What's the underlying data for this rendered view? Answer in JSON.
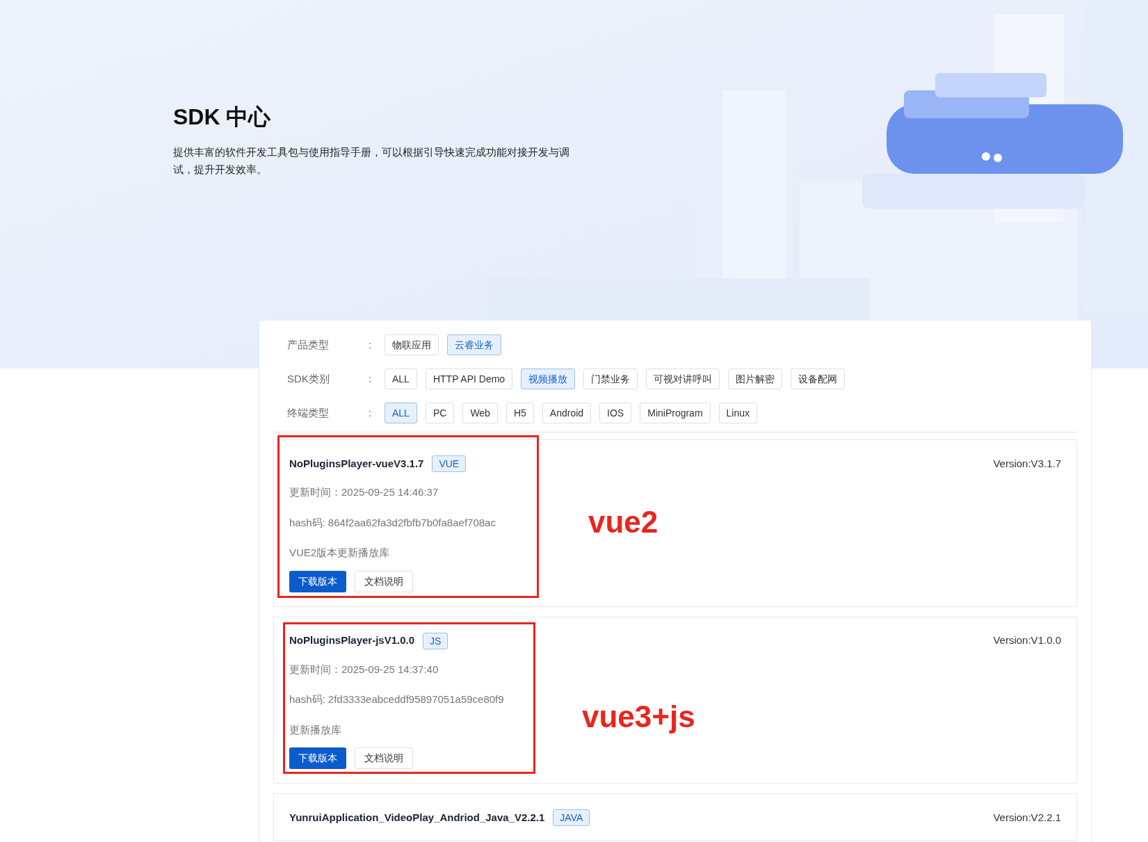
{
  "header": {
    "title": "SDK 中心",
    "description": "提供丰富的软件开发工具包与使用指导手册，可以根据引导快速完成功能对接开发与调试，提升开发效率。"
  },
  "filters": [
    {
      "label": "产品类型",
      "colon": ":",
      "options": [
        {
          "label": "物联应用",
          "selected": false
        },
        {
          "label": "云睿业务",
          "selected": true
        }
      ]
    },
    {
      "label": "SDK类别",
      "colon": ":",
      "options": [
        {
          "label": "ALL",
          "selected": false
        },
        {
          "label": "HTTP API Demo",
          "selected": false
        },
        {
          "label": "视频播放",
          "selected": true
        },
        {
          "label": "门禁业务",
          "selected": false
        },
        {
          "label": "可视对讲呼叫",
          "selected": false
        },
        {
          "label": "图片解密",
          "selected": false
        },
        {
          "label": "设备配网",
          "selected": false
        }
      ]
    },
    {
      "label": "终端类型",
      "colon": ":",
      "options": [
        {
          "label": "ALL",
          "selected": true
        },
        {
          "label": "PC",
          "selected": false
        },
        {
          "label": "Web",
          "selected": false
        },
        {
          "label": "H5",
          "selected": false
        },
        {
          "label": "Android",
          "selected": false
        },
        {
          "label": "IOS",
          "selected": false
        },
        {
          "label": "MiniProgram",
          "selected": false
        },
        {
          "label": "Linux",
          "selected": false
        }
      ]
    }
  ],
  "sdks": [
    {
      "name": "NoPluginsPlayer-vueV3.1.7",
      "tag": "VUE",
      "version": "Version:V3.1.7",
      "updated": "更新时间：2025-09-25 14:46:37",
      "hash": "hash码: 864f2aa62fa3d2fbfb7b0fa8aef708ac",
      "description": "VUE2版本更新播放库",
      "buttons": [
        {
          "label": "下载版本",
          "kind": "primary"
        },
        {
          "label": "文档说明",
          "kind": "default"
        }
      ],
      "annotation": "vue2"
    },
    {
      "name": "NoPluginsPlayer-jsV1.0.0",
      "tag": "JS",
      "version": "Version:V1.0.0",
      "updated": "更新时间：2025-09-25 14:37:40",
      "hash": "hash码: 2fd3333eabceddf95897051a59ce80f9",
      "description": "更新播放库",
      "buttons": [
        {
          "label": "下载版本",
          "kind": "primary"
        },
        {
          "label": "文档说明",
          "kind": "default"
        }
      ],
      "annotation": "vue3+js"
    },
    {
      "name": "YunruiApplication_VideoPlay_Andriod_Java_V2.2.1",
      "tag": "JAVA",
      "version": "Version:V2.2.1"
    }
  ]
}
